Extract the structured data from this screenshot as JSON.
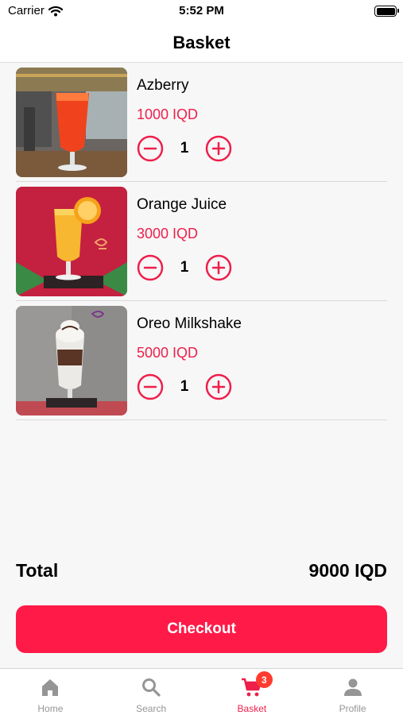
{
  "status_bar": {
    "carrier": "Carrier",
    "time": "5:52 PM",
    "icons": [
      "wifi-icon",
      "battery-icon"
    ]
  },
  "header": {
    "title": "Basket"
  },
  "items": [
    {
      "name": "Azberry",
      "price": "1000 IQD",
      "quantity": "1",
      "image": "red-juice-glass-photo"
    },
    {
      "name": "Orange Juice",
      "price": "3000 IQD",
      "quantity": "1",
      "image": "orange-juice-glass-photo"
    },
    {
      "name": "Oreo Milkshake",
      "price": "5000 IQD",
      "quantity": "1",
      "image": "oreo-milkshake-glass-photo"
    }
  ],
  "summary": {
    "total_label": "Total",
    "total_value": "9000 IQD"
  },
  "checkout": {
    "label": "Checkout"
  },
  "tabs": [
    {
      "label": "Home",
      "icon": "home-icon",
      "active": false
    },
    {
      "label": "Search",
      "icon": "search-icon",
      "active": false
    },
    {
      "label": "Basket",
      "icon": "cart-icon",
      "active": true,
      "badge": "3"
    },
    {
      "label": "Profile",
      "icon": "person-icon",
      "active": false
    }
  ],
  "colors": {
    "accent": "#ee1f4b",
    "button": "#ff1a48",
    "badge": "#ff3b30",
    "tab_inactive": "#959595"
  }
}
